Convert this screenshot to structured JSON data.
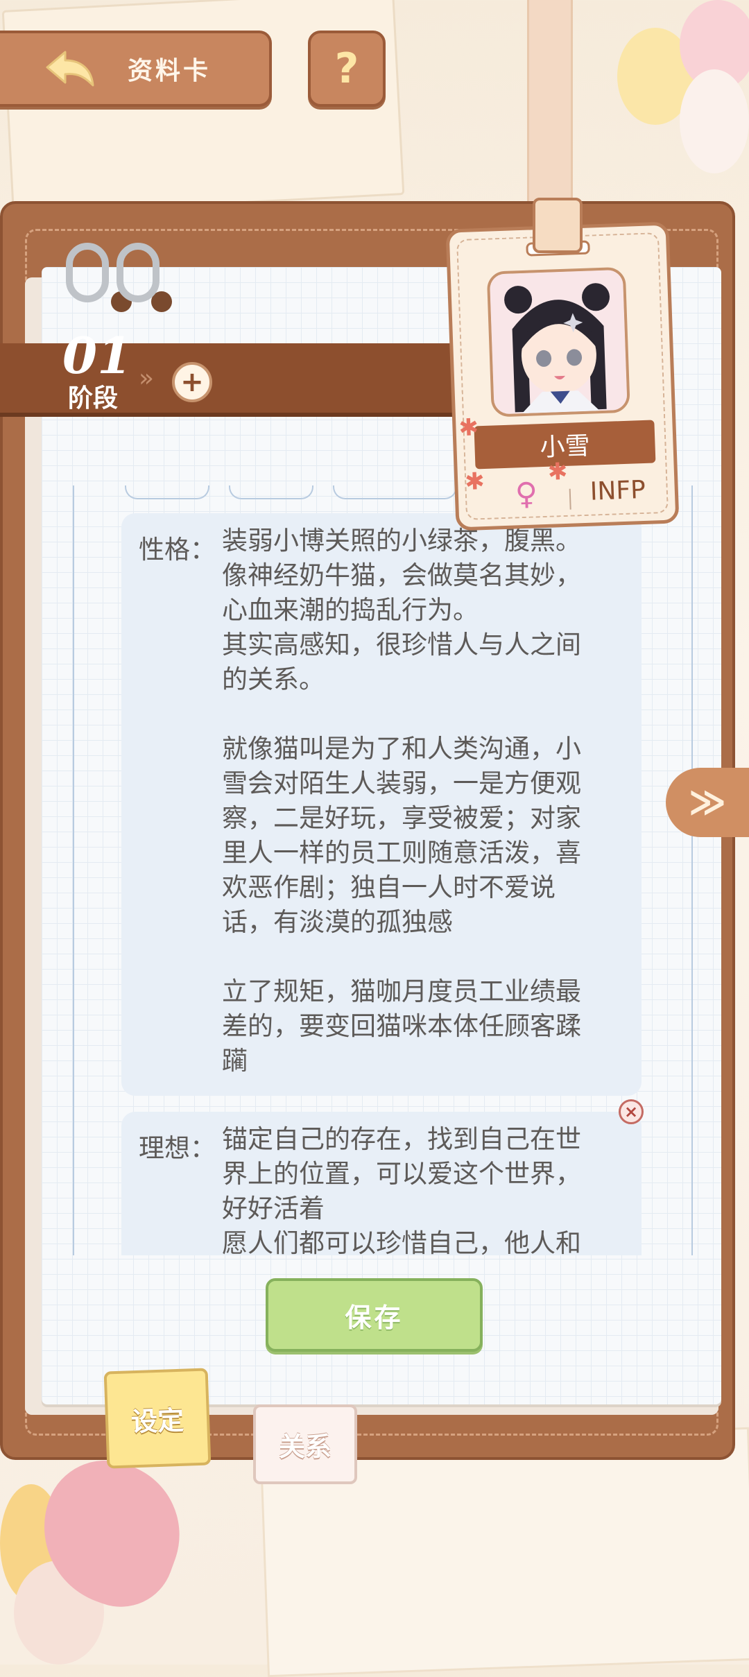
{
  "header": {
    "back_label": "资料卡",
    "help_label": "?"
  },
  "stage": {
    "number": "01",
    "label": "阶段",
    "chevron": "»",
    "add_label": "+"
  },
  "character": {
    "name": "小雪",
    "gender_symbol": "♀",
    "mbti": "INFP",
    "avatar_icon": "chibi-girl-avatar"
  },
  "traits": [
    {
      "label": "性格：",
      "text": "装弱小博关照的小绿茶，腹黑。\n像神经奶牛猫，会做莫名其妙，\n心血来潮的捣乱行为。\n其实高感知，很珍惜人与人之间\n的关系。\n\n就像猫叫是为了和人类沟通，小\n雪会对陌生人装弱，一是方便观\n察，二是好玩，享受被爱；对家\n里人一样的员工则随意活泼，喜\n欢恶作剧；独自一人时不爱说\n话，有淡漠的孤独感\n\n立了规矩，猫咖月度员工业绩最\n差的，要变回猫咪本体任顾客蹂\n躏"
    },
    {
      "label": "理想：",
      "text": "锚定自己的存在，找到自己在世\n界上的位置，可以爱这个世界，\n好好活着\n愿人们都可以珍惜自己，他人和"
    }
  ],
  "close_label": "×",
  "next_label": "≫",
  "save_label": "保存",
  "tabs": {
    "settings": "设定",
    "relations": "关系"
  },
  "colors": {
    "brown": "#ab6d48",
    "save_green": "#bfe08b",
    "card_bg": "#e8eff7",
    "text": "#5d5a58"
  }
}
